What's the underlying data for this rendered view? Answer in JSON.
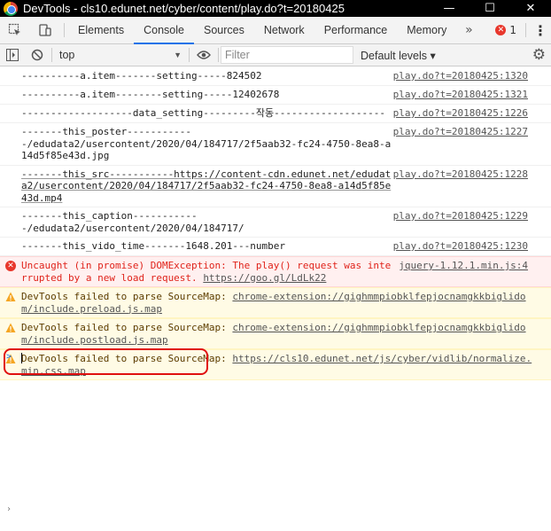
{
  "window": {
    "title": "DevTools - cls10.edunet.net/cyber/content/play.do?t=20180425",
    "minimize": "—",
    "maximize": "☐",
    "close": "✕"
  },
  "tabs": [
    {
      "label": "Elements"
    },
    {
      "label": "Console"
    },
    {
      "label": "Sources"
    },
    {
      "label": "Network"
    },
    {
      "label": "Performance"
    },
    {
      "label": "Memory"
    }
  ],
  "tabs_more": "»",
  "error_count": "1",
  "toolbar": {
    "context": "top",
    "filter_placeholder": "Filter",
    "levels": "Default levels ▾"
  },
  "messages": [
    {
      "text": "----------a.item-------setting-----824502",
      "source": "play.do?t=20180425:1320"
    },
    {
      "text": "----------a.item--------setting-----12402678",
      "source": "play.do?t=20180425:1321"
    },
    {
      "text": "-------------------data_setting---------작동-------------------",
      "source": "play.do?t=20180425:1226"
    },
    {
      "text": "-------this_poster-----------\n-/edudata2/usercontent/2020/04/184717/2f5aab32-fc24-4750-8ea8-a14d5f85e43d.jpg",
      "source": "play.do?t=20180425:1227"
    },
    {
      "text": "-------this_src-----------https://content-cdn.edunet.net/edudata2/usercontent/2020/04/184717/2f5aab32-fc24-4750-8ea8-a14d5f85e43d.mp4",
      "source": "play.do?t=20180425:1228"
    },
    {
      "text": "-------this_caption-----------\n-/edudata2/usercontent/2020/04/184717/",
      "source": "play.do?t=20180425:1229"
    },
    {
      "text": "-------this_vido_time-------1648.201---number",
      "source": "play.do?t=20180425:1230"
    }
  ],
  "error_message": {
    "text": "Uncaught (in promise) DOMException: The play() request was interrupted by a new load request. ",
    "link": "https://goo.gl/LdLk22",
    "source": "jquery-1.12.1.min.js:4"
  },
  "warnings": [
    {
      "text": "DevTools failed to parse SourceMap: ",
      "link": "chrome-extension://gighmmpiobklfepjocnamgkkbiglidom/include.preload.js.map"
    },
    {
      "text": "DevTools failed to parse SourceMap: ",
      "link": "chrome-extension://gighmmpiobklfepjocnamgkkbiglidom/include.postload.js.map"
    },
    {
      "text": "DevTools failed to parse SourceMap: ",
      "link": "https://cls10.edunet.net/js/cyber/vidlib/normalize.min.css.map"
    }
  ],
  "prompt_symbol": ">",
  "bottom_caret": "›",
  "colors": {
    "accent": "#1a73e8",
    "error": "#e8372c",
    "warning": "#f5a623",
    "highlight": "#e01010"
  }
}
